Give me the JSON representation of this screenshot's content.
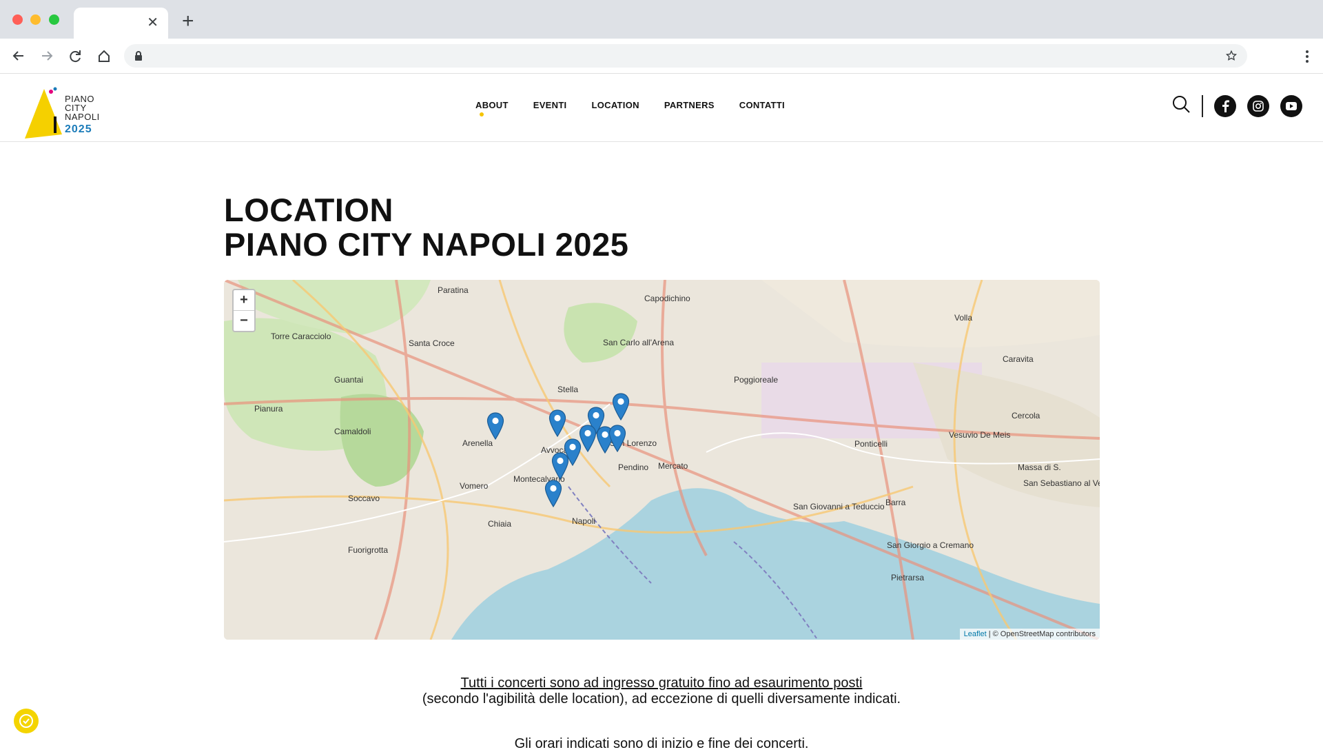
{
  "browser": {
    "tab_title": "",
    "new_tab_symbol": "+",
    "close_symbol": "✕",
    "url": ""
  },
  "site": {
    "logo": {
      "line1": "PIANO",
      "line2": "CITY",
      "line3": "NAPOLI",
      "year": "2025"
    },
    "nav": [
      "ABOUT",
      "EVENTI",
      "LOCATION",
      "PARTNERS",
      "CONTATTI"
    ],
    "icons": [
      "search-icon",
      "facebook-icon",
      "instagram-icon",
      "youtube-icon"
    ],
    "accent_color": "#f5c400"
  },
  "content": {
    "title_line1": "LOCATION",
    "title_line2": "PIANO CITY NAPOLI 2025",
    "notice_underlined": "Tutti i concerti sono ad ingresso gratuito fino ad esaurimento posti",
    "notice_rest": "(secondo l'agibilità delle location), ad eccezione di quelli diversamente indicati.",
    "hours": "Gli orari indicati sono di inizio e fine dei concerti."
  },
  "map": {
    "zoom_in": "+",
    "zoom_out": "−",
    "attribution_leaflet": "Leaflet",
    "attribution_rest": "| © OpenStreetMap contributors",
    "places": {
      "paratina": "Paratina",
      "capodichino": "Capodichino",
      "volla": "Volla",
      "torre": "Torre Caracciolo",
      "santacroce": "Santa Croce",
      "sancarlo": "San Carlo all'Arena",
      "guantai": "Guantai",
      "pianura": "Pianura",
      "stella": "Stella",
      "poggioreale": "Poggioreale",
      "caravita": "Caravita",
      "cercola": "Cercola",
      "camaldoli": "Camaldoli",
      "arenella": "Arenella",
      "avvocata": "Avvocata",
      "slorenzo": "San Lorenzo",
      "ponticelli": "Ponticelli",
      "vesuvio": "Vesuvio De Meis",
      "pendino": "Pendino",
      "mercato": "Mercato",
      "vomero": "Vomero",
      "montecalvario": "Montecalvario",
      "soccavo": "Soccavo",
      "chiaia": "Chiaia",
      "napoli": "Napoli",
      "sangiovanni": "San Giovanni a Teduccio",
      "barra": "Barra",
      "fuorigrotta": "Fuorigrotta",
      "sangiorgio": "San Giorgio a Cremano",
      "pietrarsa": "Pietrarsa",
      "massa": "Massa di S.",
      "sansebastiano": "San Sebastiano al Vesuvio"
    },
    "marker_count": 10
  },
  "accessibility_button": "accessibility-icon"
}
